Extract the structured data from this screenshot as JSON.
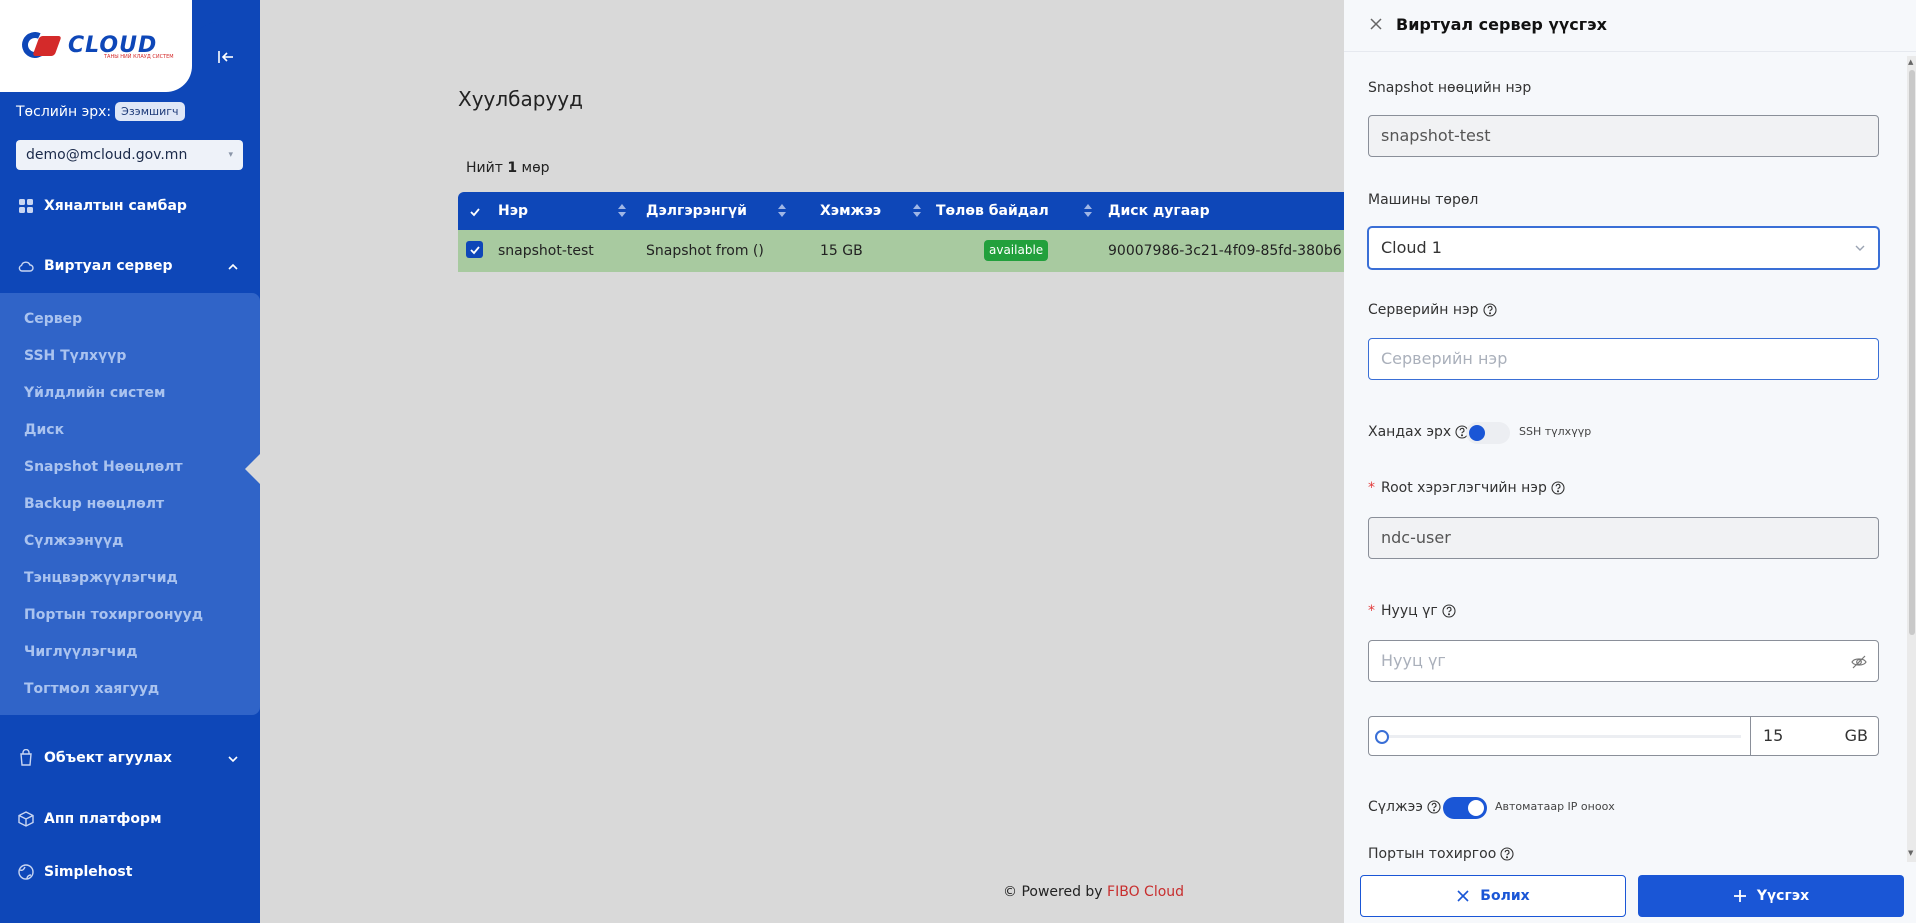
{
  "logo": {
    "text": "CLOUD",
    "tagline": "ТАНЫ НИЙ КЛАУД СИСТЕМ"
  },
  "sidebar": {
    "role_label": "Төслийн эрх:",
    "role_badge": "Эзэмшигч",
    "account": "demo@mcloud.gov.mn",
    "items": {
      "dashboard": "Хяналтын самбар",
      "virtual_server": "Виртуал сервер",
      "object_storage": "Объект агуулах",
      "app_platform": "Апп платформ",
      "simplehost": "Simplehost"
    },
    "submenu": [
      "Сервер",
      "SSH Түлхүүр",
      "Үйлдлийн систем",
      "Диск",
      "Snapshot Нөөцлөлт",
      "Backup нөөцлөлт",
      "Сүлжээнүүд",
      "Тэнцвэржүүлэгчид",
      "Портын тохиргоонууд",
      "Чиглүүлэгчид",
      "Тогтмол хаягууд"
    ]
  },
  "main": {
    "title": "Хуулбарууд",
    "count_prefix": "Нийт",
    "count_value": "1",
    "count_suffix": "мөр",
    "columns": [
      "Нэр",
      "Дэлгэрэнгүй",
      "Хэмжээ",
      "Төлөв байдал",
      "Диск дугаар"
    ],
    "rows": [
      {
        "name": "snapshot-test",
        "detail": "Snapshot from ()",
        "size": "15 GB",
        "status": "available",
        "disk_id": "90007986-3c21-4f09-85fd-380b6"
      }
    ],
    "footer_prefix": "© Powered by",
    "footer_brand": "FIBO Cloud"
  },
  "drawer": {
    "title": "Виртуал сервер үүсгэх",
    "snapshot_label": "Snapshot нөөцийн нэр",
    "snapshot_value": "snapshot-test",
    "machine_label": "Машины төрөл",
    "machine_value": "Cloud 1",
    "server_label": "Серверийн нэр",
    "server_placeholder": "Серверийн нэр",
    "access_label": "Хандах эрх",
    "access_toggle_text": "SSH түлхүүр",
    "root_label": "Root хэрэглэгчийн нэр",
    "root_value": "ndc-user",
    "password_label": "Нууц үг",
    "password_placeholder": "Нууц үг",
    "disk_value": "15",
    "disk_unit": "GB",
    "network_label": "Сүлжээ",
    "network_toggle_text": "Автоматаар IP оноох",
    "port_label": "Портын тохиргоо",
    "cancel_label": "Болих",
    "create_label": "Үүсгэх"
  },
  "colors": {
    "sidebar": "#0e47b8",
    "submenu": "#3064c8",
    "row_selected": "#a8caa0",
    "status_available": "#22a03c",
    "primary": "#1a56d6",
    "brand_red": "#c82e2e"
  }
}
